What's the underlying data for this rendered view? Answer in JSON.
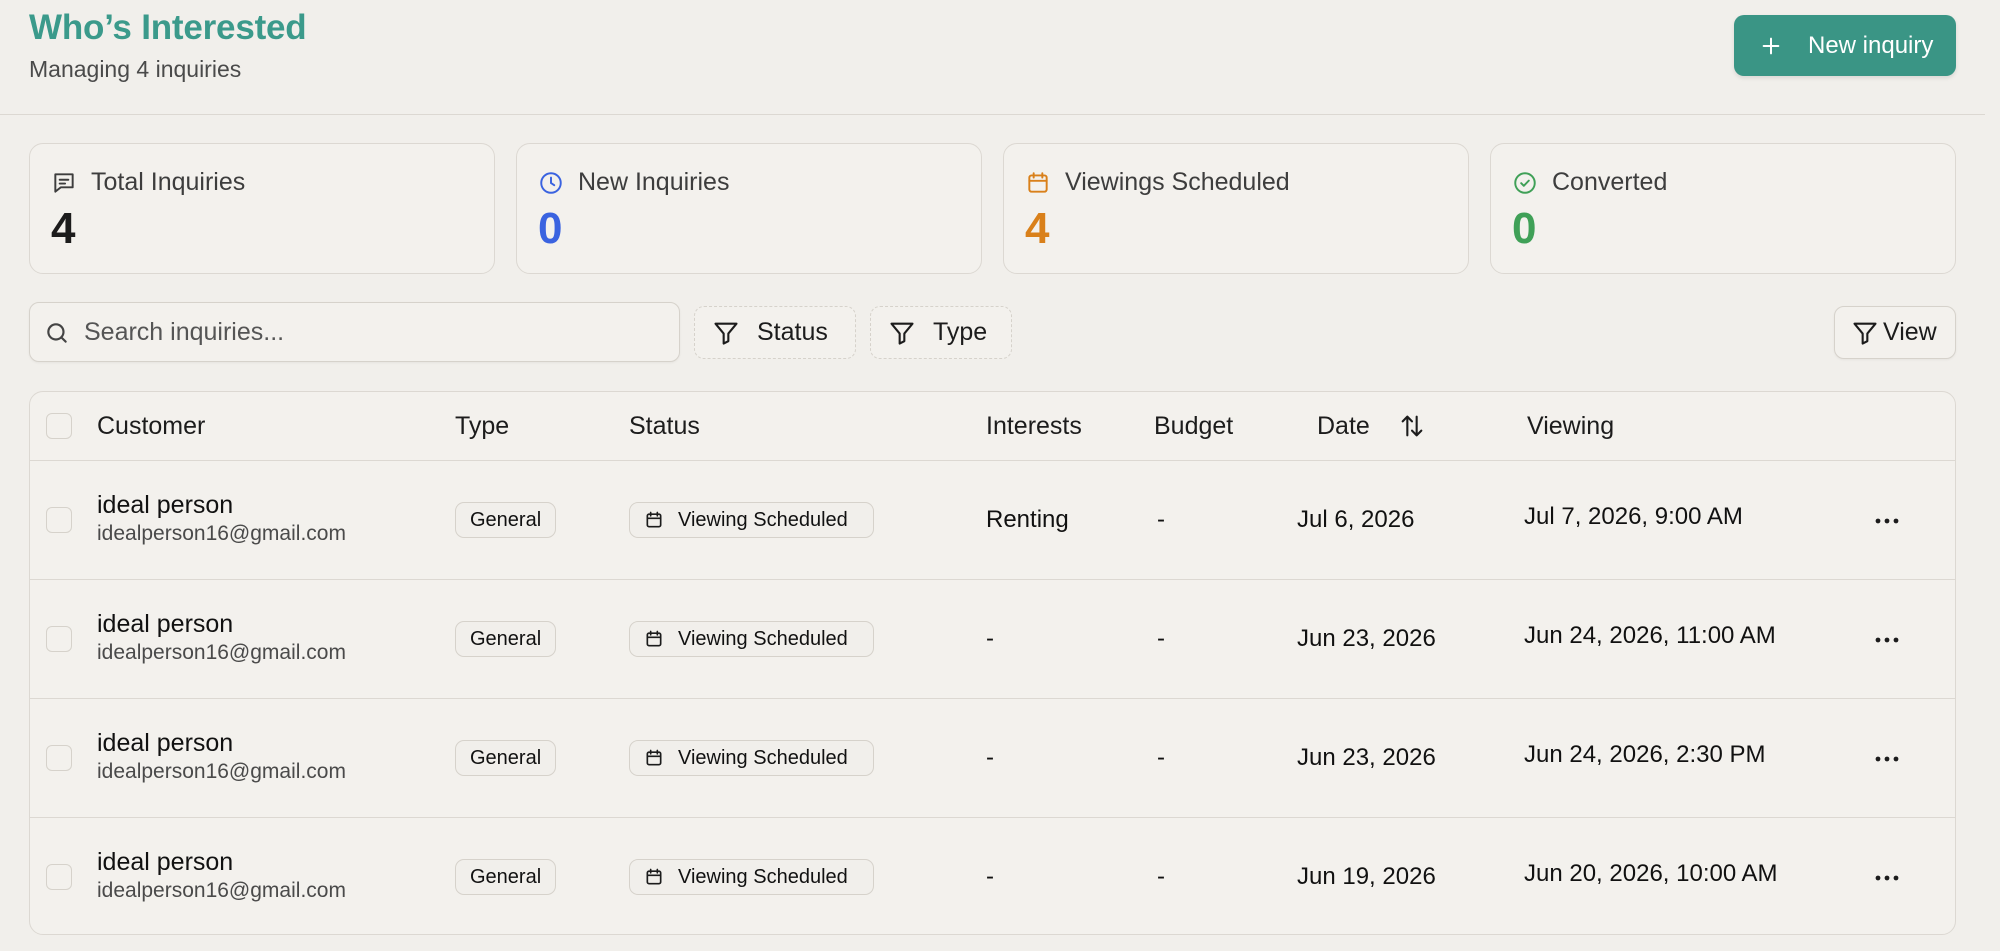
{
  "header": {
    "title": "Who’s Interested",
    "subtitle": "Managing 4 inquiries",
    "new_inquiry_label": "New inquiry"
  },
  "stats": [
    {
      "label": "Total Inquiries",
      "value": "4",
      "icon": "message-square-icon",
      "color": "#1c1c1c"
    },
    {
      "label": "New Inquiries",
      "value": "0",
      "icon": "clock-icon",
      "color": "#3a63e0"
    },
    {
      "label": "Viewings Scheduled",
      "value": "4",
      "icon": "calendar-icon",
      "color": "#d9801a"
    },
    {
      "label": "Converted",
      "value": "0",
      "icon": "check-circle-icon",
      "color": "#3fa057"
    }
  ],
  "toolbar": {
    "search_placeholder": "Search inquiries...",
    "status_filter_label": "Status",
    "type_filter_label": "Type",
    "view_label": "View"
  },
  "table": {
    "columns": {
      "customer": "Customer",
      "type": "Type",
      "status": "Status",
      "interests": "Interests",
      "budget": "Budget",
      "date": "Date",
      "viewing": "Viewing"
    },
    "rows": [
      {
        "name": "ideal person",
        "email": "idealperson16@gmail.com",
        "type": "General",
        "status": "Viewing Scheduled",
        "interests": "Renting",
        "budget": "-",
        "date": "Jul 6, 2026",
        "viewing": "Jul 7, 2026, 9:00 AM"
      },
      {
        "name": "ideal person",
        "email": "idealperson16@gmail.com",
        "type": "General",
        "status": "Viewing Scheduled",
        "interests": "-",
        "budget": "-",
        "date": "Jun 23, 2026",
        "viewing": "Jun 24, 2026, 11:00 AM"
      },
      {
        "name": "ideal person",
        "email": "idealperson16@gmail.com",
        "type": "General",
        "status": "Viewing Scheduled",
        "interests": "-",
        "budget": "-",
        "date": "Jun 23, 2026",
        "viewing": "Jun 24, 2026, 2:30 PM"
      },
      {
        "name": "ideal person",
        "email": "idealperson16@gmail.com",
        "type": "General",
        "status": "Viewing Scheduled",
        "interests": "-",
        "budget": "-",
        "date": "Jun 19, 2026",
        "viewing": "Jun 20, 2026, 10:00 AM"
      }
    ]
  }
}
